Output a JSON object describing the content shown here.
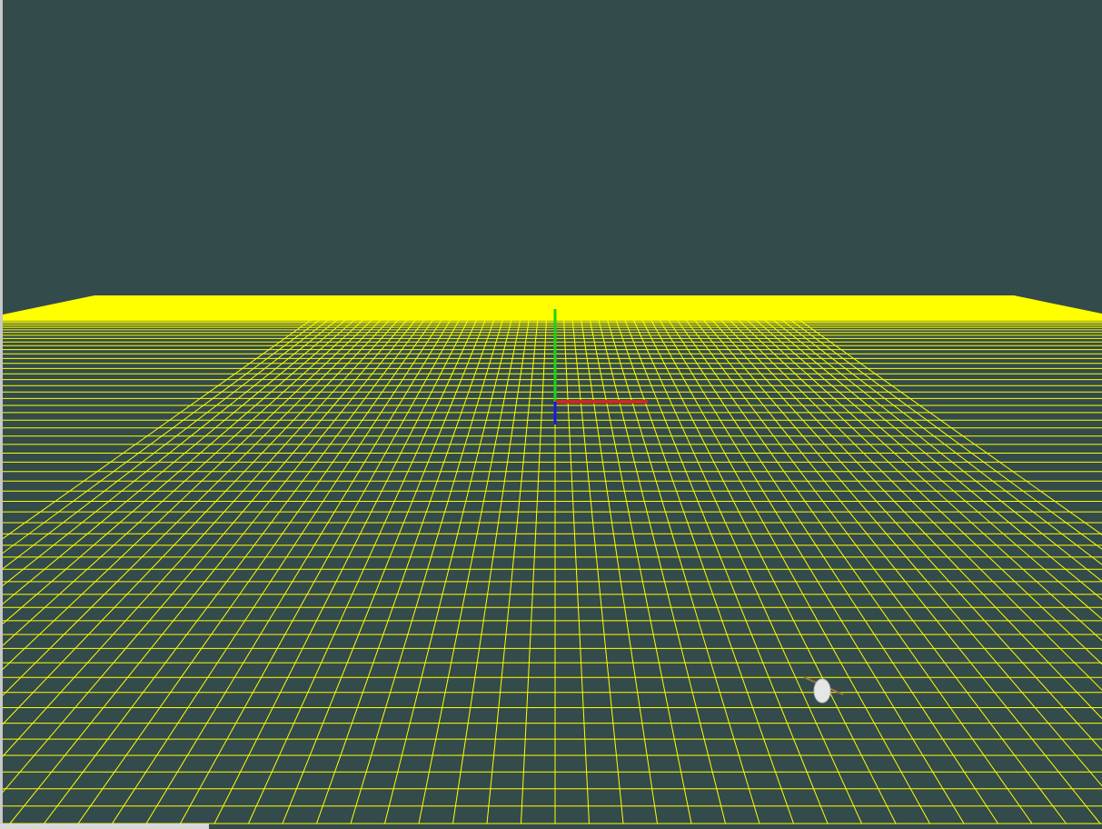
{
  "colors": {
    "background": "#334b4b",
    "grid": "#ffff00",
    "axis_x": "#c62a2a",
    "axis_y": "#18d418",
    "axis_z": "#1818e0",
    "model": "#e6e6e6"
  },
  "scene": {
    "description_icons": [
      "x-axis-marker",
      "y-axis-marker",
      "z-axis-marker",
      "model-object"
    ]
  },
  "status_bar": {
    "text": ""
  }
}
